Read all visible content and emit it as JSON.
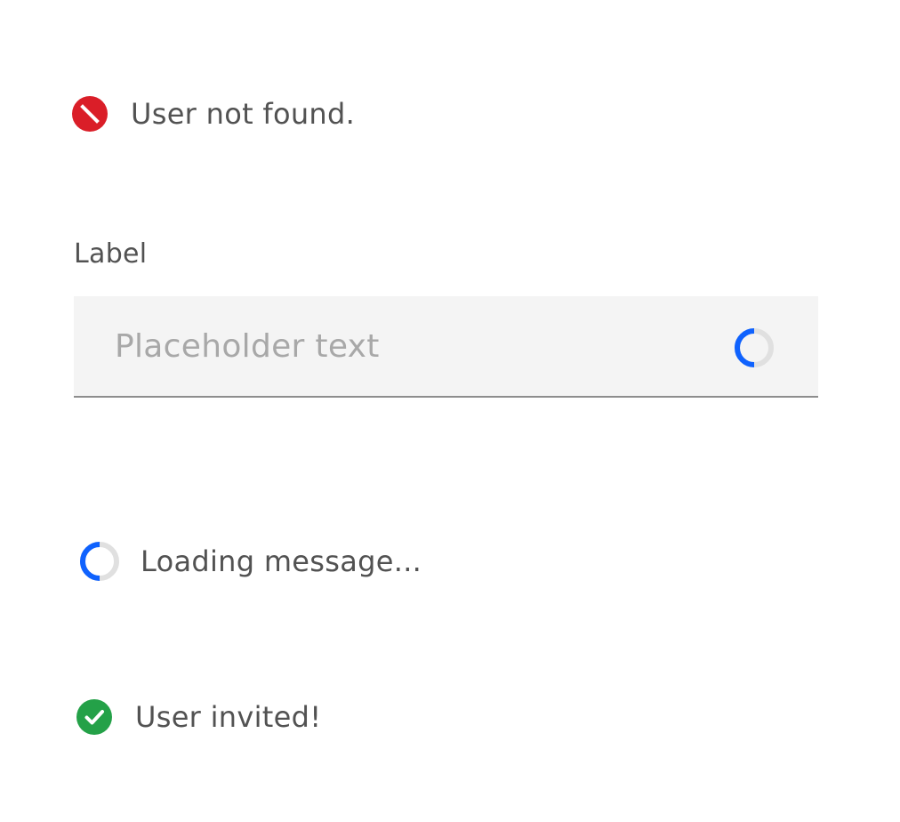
{
  "error_status": {
    "message": "User not found.",
    "icon": "error-icon",
    "color": "#da1e28"
  },
  "text_field": {
    "label": "Label",
    "value": "",
    "placeholder": "Placeholder text",
    "loading_icon": "loading-spinner-icon",
    "accent_color": "#0f62fe"
  },
  "loading_status": {
    "message": "Loading message...",
    "icon": "loading-spinner-icon",
    "color": "#0f62fe"
  },
  "success_status": {
    "message": "User invited!",
    "icon": "checkmark-icon",
    "color": "#24a148"
  }
}
